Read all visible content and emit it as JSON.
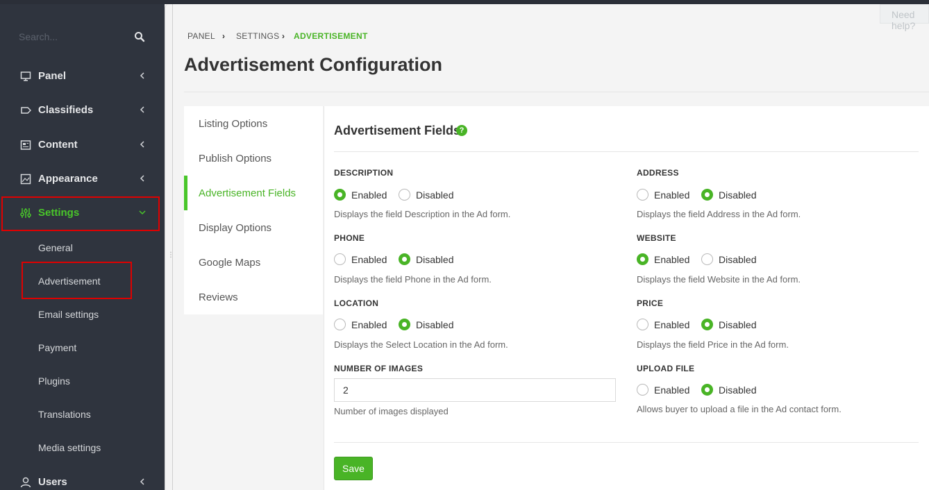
{
  "sidebar": {
    "search_placeholder": "Search...",
    "items": [
      {
        "label": "Panel",
        "icon": "monitor-icon"
      },
      {
        "label": "Classifieds",
        "icon": "tag-icon"
      },
      {
        "label": "Content",
        "icon": "newspaper-icon"
      },
      {
        "label": "Appearance",
        "icon": "image-icon"
      },
      {
        "label": "Settings",
        "icon": "sliders-icon"
      },
      {
        "label": "Users",
        "icon": "user-icon"
      }
    ],
    "settings_sub": [
      "General",
      "Advertisement",
      "Email settings",
      "Payment",
      "Plugins",
      "Translations",
      "Media settings"
    ]
  },
  "header": {
    "help": "Need help?",
    "breadcrumb": [
      "PANEL",
      "SETTINGS",
      "ADVERTISEMENT"
    ],
    "title": "Advertisement Configuration"
  },
  "tabs": [
    "Listing Options",
    "Publish Options",
    "Advertisement Fields",
    "Display Options",
    "Google Maps",
    "Reviews"
  ],
  "active_tab": "Advertisement Fields",
  "section": {
    "title": "Advertisement Fields",
    "help_badge": "?"
  },
  "radio_labels": {
    "enabled": "Enabled",
    "disabled": "Disabled"
  },
  "fields": {
    "description": {
      "label": "DESCRIPTION",
      "value": "Enabled",
      "help": "Displays the field Description in the Ad form."
    },
    "address": {
      "label": "ADDRESS",
      "value": "Disabled",
      "help": "Displays the field Address in the Ad form."
    },
    "phone": {
      "label": "PHONE",
      "value": "Disabled",
      "help": "Displays the field Phone in the Ad form."
    },
    "website": {
      "label": "WEBSITE",
      "value": "Enabled",
      "help": "Displays the field Website in the Ad form."
    },
    "location": {
      "label": "LOCATION",
      "value": "Disabled",
      "help": "Displays the Select Location in the Ad form."
    },
    "price": {
      "label": "PRICE",
      "value": "Disabled",
      "help": "Displays the field Price in the Ad form."
    },
    "number_of_images": {
      "label": "NUMBER OF IMAGES",
      "value": "2",
      "help": "Number of images displayed"
    },
    "upload_file": {
      "label": "UPLOAD FILE",
      "value": "Disabled",
      "help": "Allows buyer to upload a file in the Ad contact form."
    }
  },
  "save_label": "Save",
  "colors": {
    "accent": "#49b426",
    "sidebar_bg": "#2f343e",
    "highlight_box": "#e00000"
  }
}
